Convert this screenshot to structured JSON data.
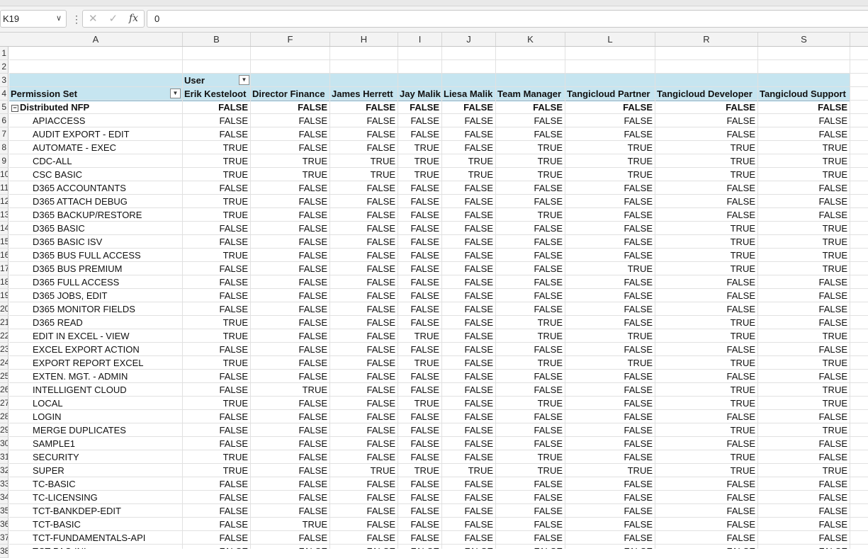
{
  "formula_bar": {
    "name_box": "K19",
    "formula": "0"
  },
  "columns": [
    "A",
    "B",
    "F",
    "H",
    "I",
    "J",
    "K",
    "L",
    "R",
    "S"
  ],
  "row_numbers": [
    "1",
    "2",
    "3",
    "4",
    "5",
    "6",
    "7",
    "8",
    "9",
    "10",
    "11",
    "12",
    "13",
    "14",
    "15",
    "16",
    "17",
    "18",
    "19",
    "20",
    "21",
    "22",
    "23",
    "24",
    "25",
    "26",
    "27",
    "28",
    "29",
    "30",
    "31",
    "32",
    "33",
    "34",
    "35",
    "36",
    "37",
    "38"
  ],
  "pivot": {
    "user_label": "User",
    "row_header": "Permission Set",
    "column_users": [
      "Erik Kesteloot",
      "Director Finance",
      "James Herrett",
      "Jay Malik",
      "Liesa Malik",
      "Team Manager",
      "Tangicloud Partner",
      "Tangicloud Developer",
      "Tangicloud Support"
    ],
    "group": {
      "label": "Distributed NFP",
      "values": [
        "FALSE",
        "FALSE",
        "FALSE",
        "FALSE",
        "FALSE",
        "FALSE",
        "FALSE",
        "FALSE",
        "FALSE"
      ]
    },
    "rows": [
      {
        "label": "APIACCESS",
        "values": [
          "FALSE",
          "FALSE",
          "FALSE",
          "FALSE",
          "FALSE",
          "FALSE",
          "FALSE",
          "FALSE",
          "FALSE"
        ]
      },
      {
        "label": "AUDIT EXPORT - EDIT",
        "values": [
          "FALSE",
          "FALSE",
          "FALSE",
          "FALSE",
          "FALSE",
          "FALSE",
          "FALSE",
          "FALSE",
          "FALSE"
        ]
      },
      {
        "label": "AUTOMATE - EXEC",
        "values": [
          "TRUE",
          "FALSE",
          "FALSE",
          "TRUE",
          "FALSE",
          "TRUE",
          "TRUE",
          "TRUE",
          "TRUE"
        ]
      },
      {
        "label": "CDC-ALL",
        "values": [
          "TRUE",
          "TRUE",
          "TRUE",
          "TRUE",
          "TRUE",
          "TRUE",
          "TRUE",
          "TRUE",
          "TRUE"
        ]
      },
      {
        "label": "CSC BASIC",
        "values": [
          "TRUE",
          "TRUE",
          "TRUE",
          "TRUE",
          "TRUE",
          "TRUE",
          "TRUE",
          "TRUE",
          "TRUE"
        ]
      },
      {
        "label": "D365 ACCOUNTANTS",
        "values": [
          "FALSE",
          "FALSE",
          "FALSE",
          "FALSE",
          "FALSE",
          "FALSE",
          "FALSE",
          "FALSE",
          "FALSE"
        ]
      },
      {
        "label": "D365 ATTACH DEBUG",
        "values": [
          "TRUE",
          "FALSE",
          "FALSE",
          "FALSE",
          "FALSE",
          "FALSE",
          "FALSE",
          "FALSE",
          "FALSE"
        ]
      },
      {
        "label": "D365 BACKUP/RESTORE",
        "values": [
          "TRUE",
          "FALSE",
          "FALSE",
          "FALSE",
          "FALSE",
          "TRUE",
          "FALSE",
          "FALSE",
          "FALSE"
        ]
      },
      {
        "label": "D365 BASIC",
        "values": [
          "FALSE",
          "FALSE",
          "FALSE",
          "FALSE",
          "FALSE",
          "FALSE",
          "FALSE",
          "TRUE",
          "TRUE"
        ]
      },
      {
        "label": "D365 BASIC ISV",
        "values": [
          "FALSE",
          "FALSE",
          "FALSE",
          "FALSE",
          "FALSE",
          "FALSE",
          "FALSE",
          "TRUE",
          "TRUE"
        ]
      },
      {
        "label": "D365 BUS FULL ACCESS",
        "values": [
          "TRUE",
          "FALSE",
          "FALSE",
          "FALSE",
          "FALSE",
          "FALSE",
          "FALSE",
          "TRUE",
          "TRUE"
        ]
      },
      {
        "label": "D365 BUS PREMIUM",
        "values": [
          "FALSE",
          "FALSE",
          "FALSE",
          "FALSE",
          "FALSE",
          "FALSE",
          "TRUE",
          "TRUE",
          "TRUE"
        ]
      },
      {
        "label": "D365 FULL ACCESS",
        "values": [
          "FALSE",
          "FALSE",
          "FALSE",
          "FALSE",
          "FALSE",
          "FALSE",
          "FALSE",
          "FALSE",
          "FALSE"
        ]
      },
      {
        "label": "D365 JOBS, EDIT",
        "values": [
          "FALSE",
          "FALSE",
          "FALSE",
          "FALSE",
          "FALSE",
          "FALSE",
          "FALSE",
          "FALSE",
          "FALSE"
        ]
      },
      {
        "label": "D365 MONITOR FIELDS",
        "values": [
          "FALSE",
          "FALSE",
          "FALSE",
          "FALSE",
          "FALSE",
          "FALSE",
          "FALSE",
          "FALSE",
          "FALSE"
        ]
      },
      {
        "label": "D365 READ",
        "values": [
          "TRUE",
          "FALSE",
          "FALSE",
          "FALSE",
          "FALSE",
          "TRUE",
          "FALSE",
          "TRUE",
          "FALSE"
        ]
      },
      {
        "label": "EDIT IN EXCEL - VIEW",
        "values": [
          "TRUE",
          "FALSE",
          "FALSE",
          "TRUE",
          "FALSE",
          "TRUE",
          "TRUE",
          "TRUE",
          "TRUE"
        ]
      },
      {
        "label": "EXCEL EXPORT ACTION",
        "values": [
          "FALSE",
          "FALSE",
          "FALSE",
          "FALSE",
          "FALSE",
          "FALSE",
          "FALSE",
          "FALSE",
          "FALSE"
        ]
      },
      {
        "label": "EXPORT REPORT EXCEL",
        "values": [
          "TRUE",
          "FALSE",
          "FALSE",
          "TRUE",
          "FALSE",
          "TRUE",
          "TRUE",
          "TRUE",
          "TRUE"
        ]
      },
      {
        "label": "EXTEN. MGT. - ADMIN",
        "values": [
          "FALSE",
          "FALSE",
          "FALSE",
          "FALSE",
          "FALSE",
          "FALSE",
          "FALSE",
          "FALSE",
          "FALSE"
        ]
      },
      {
        "label": "INTELLIGENT CLOUD",
        "values": [
          "FALSE",
          "TRUE",
          "FALSE",
          "FALSE",
          "FALSE",
          "FALSE",
          "FALSE",
          "TRUE",
          "TRUE"
        ]
      },
      {
        "label": "LOCAL",
        "values": [
          "TRUE",
          "FALSE",
          "FALSE",
          "TRUE",
          "FALSE",
          "TRUE",
          "FALSE",
          "TRUE",
          "TRUE"
        ]
      },
      {
        "label": "LOGIN",
        "values": [
          "FALSE",
          "FALSE",
          "FALSE",
          "FALSE",
          "FALSE",
          "FALSE",
          "FALSE",
          "FALSE",
          "FALSE"
        ]
      },
      {
        "label": "MERGE DUPLICATES",
        "values": [
          "FALSE",
          "FALSE",
          "FALSE",
          "FALSE",
          "FALSE",
          "FALSE",
          "FALSE",
          "TRUE",
          "TRUE"
        ]
      },
      {
        "label": "SAMPLE1",
        "values": [
          "FALSE",
          "FALSE",
          "FALSE",
          "FALSE",
          "FALSE",
          "FALSE",
          "FALSE",
          "FALSE",
          "FALSE"
        ]
      },
      {
        "label": "SECURITY",
        "values": [
          "TRUE",
          "FALSE",
          "FALSE",
          "FALSE",
          "FALSE",
          "TRUE",
          "FALSE",
          "TRUE",
          "FALSE"
        ]
      },
      {
        "label": "SUPER",
        "values": [
          "TRUE",
          "FALSE",
          "TRUE",
          "TRUE",
          "TRUE",
          "TRUE",
          "TRUE",
          "TRUE",
          "TRUE"
        ]
      },
      {
        "label": "TC-BASIC",
        "values": [
          "FALSE",
          "FALSE",
          "FALSE",
          "FALSE",
          "FALSE",
          "FALSE",
          "FALSE",
          "FALSE",
          "FALSE"
        ]
      },
      {
        "label": "TC-LICENSING",
        "values": [
          "FALSE",
          "FALSE",
          "FALSE",
          "FALSE",
          "FALSE",
          "FALSE",
          "FALSE",
          "FALSE",
          "FALSE"
        ]
      },
      {
        "label": "TCT-BANKDEP-EDIT",
        "values": [
          "FALSE",
          "FALSE",
          "FALSE",
          "FALSE",
          "FALSE",
          "FALSE",
          "FALSE",
          "FALSE",
          "FALSE"
        ]
      },
      {
        "label": "TCT-BASIC",
        "values": [
          "FALSE",
          "TRUE",
          "FALSE",
          "FALSE",
          "FALSE",
          "FALSE",
          "FALSE",
          "FALSE",
          "FALSE"
        ]
      },
      {
        "label": "TCT-FUNDAMENTALS-API",
        "values": [
          "FALSE",
          "FALSE",
          "FALSE",
          "FALSE",
          "FALSE",
          "FALSE",
          "FALSE",
          "FALSE",
          "FALSE"
        ]
      },
      {
        "label": "TCT-PAC-INI",
        "values": [
          "FALSE",
          "FALSE",
          "FALSE",
          "FALSE",
          "FALSE",
          "FALSE",
          "FALSE",
          "FALSE",
          "FALSE"
        ]
      }
    ]
  }
}
